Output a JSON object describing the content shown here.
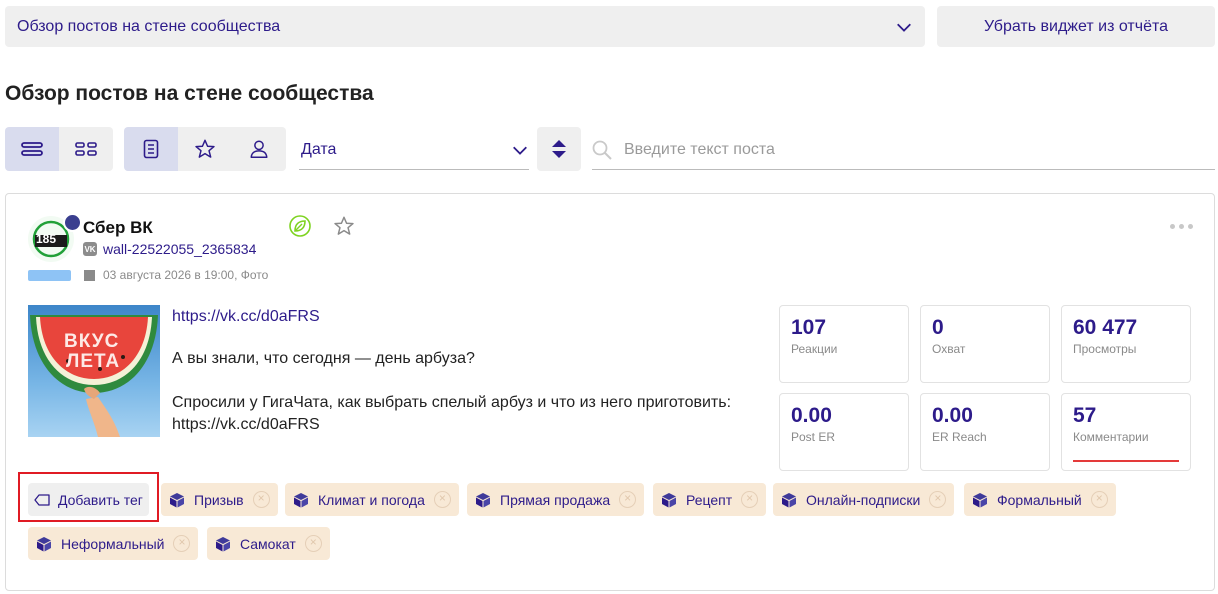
{
  "top": {
    "report_select": "Обзор постов на стене сообщества",
    "remove_widget": "Убрать виджет из отчёта"
  },
  "page_title": "Обзор постов на стене сообщества",
  "toolbar": {
    "sort_field": "Дата",
    "search_placeholder": "Введите текст поста"
  },
  "post": {
    "avatar_text": "185",
    "author": "Сбер ВК",
    "network_badge": "VK",
    "wall_id": "wall-22522055_2365834",
    "date_line": "03 августа 2026 в 19:00, Фото",
    "image_text_line1": "ВКУС",
    "image_text_line2": "ЛЕТА",
    "link": "https://vk.cc/d0aFRS",
    "paragraph1": "А вы знали, что сегодня — день арбуза?",
    "paragraph2": "Спросили у ГигаЧата, как выбрать спелый арбуз и что из него приготовить: https://vk.cc/d0aFRS"
  },
  "stats": [
    {
      "value": "107",
      "label": "Реакции"
    },
    {
      "value": "0",
      "label": "Охват"
    },
    {
      "value": "60 477",
      "label": "Просмотры"
    },
    {
      "value": "0.00",
      "label": "Post ER"
    },
    {
      "value": "0.00",
      "label": "ER Reach"
    },
    {
      "value": "57",
      "label": "Комментарии"
    }
  ],
  "add_tag_label": "Добавить тег",
  "tags": [
    {
      "label": "Призыв"
    },
    {
      "label": "Климат и погода"
    },
    {
      "label": "Прямая продажа"
    },
    {
      "label": "Рецепт"
    },
    {
      "label": "Онлайн-подписки"
    },
    {
      "label": "Формальный"
    },
    {
      "label": "Неформальный"
    },
    {
      "label": "Самокат"
    }
  ],
  "colors": {
    "accent": "#2d1b8a",
    "tag_bg": "#f8e9d6",
    "highlight": "#e01b24"
  }
}
